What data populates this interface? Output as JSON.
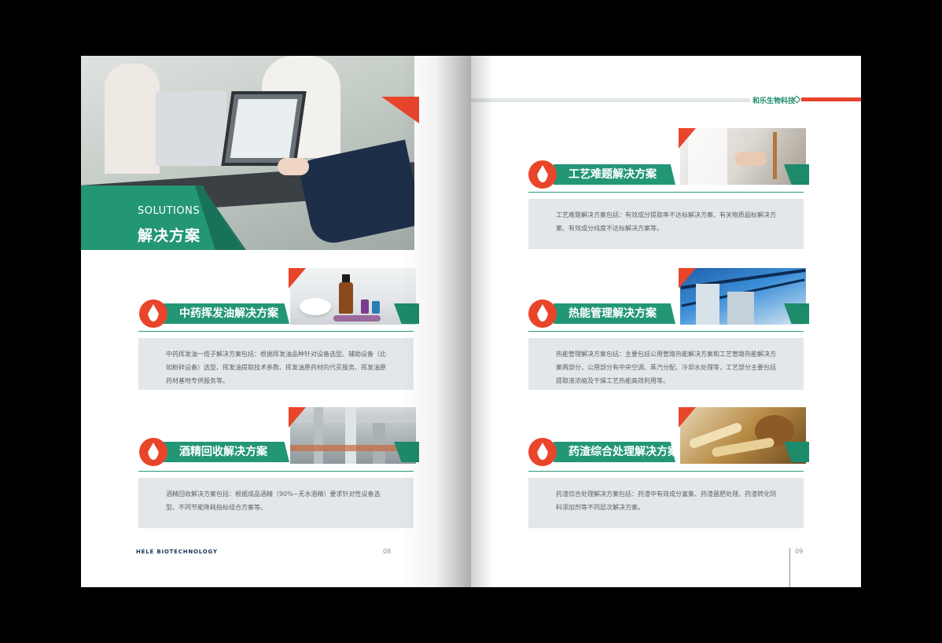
{
  "left_page": {
    "hero": {
      "title_en": "SOLUTIONS",
      "title_cn": "解决方案"
    },
    "sections": [
      {
        "title": "中药挥发油解决方案",
        "description": "中药挥发油一揽子解决方案包括：根据挥发油品种针对设备选型、辅助设备（比如粉碎设备）选型、挥发油提取技术参数、挥发油原药材的代买服务、挥发油原药材基地专供服务等。"
      },
      {
        "title": "酒精回收解决方案",
        "description": "酒精回收解决方案包括：根据成品酒精（90%~无水酒精）要求针对性设备选型、不同节能降耗指标组合方案等。"
      }
    ],
    "footer": "HELE BIOTECHNOLOGY",
    "page_number": "08"
  },
  "right_page": {
    "brand": "和乐生物科技",
    "sections": [
      {
        "title": "工艺难题解决方案",
        "description": "工艺难题解决方案包括：有效成分提取率不达标解决方案、有关物质超标解决方案、有效成分纯度不达标解决方案等。"
      },
      {
        "title": "热能管理解决方案",
        "description": "热能管理解决方案包括：主要包括公用管路热能解决方案和工艺管路热能解决方案两部分，公用部分有中央空调、蒸汽分配、冷却水处理等，工艺部分主要包括提取液浓缩及干燥工艺热能高效利用等。"
      },
      {
        "title": "药渣综合处理解决方案",
        "description": "药渣综合处理解决方案包括：药渣中有效成分富集、药渣菌肥处理、药渣转化饲料添加剂等不同层次解决方案。"
      }
    ],
    "page_number": "09"
  },
  "colors": {
    "green": "#239676",
    "dark_green": "#1d8a6a",
    "red": "#e8452b",
    "gray_box": "#e3e7ea",
    "navy": "#1b3556"
  }
}
